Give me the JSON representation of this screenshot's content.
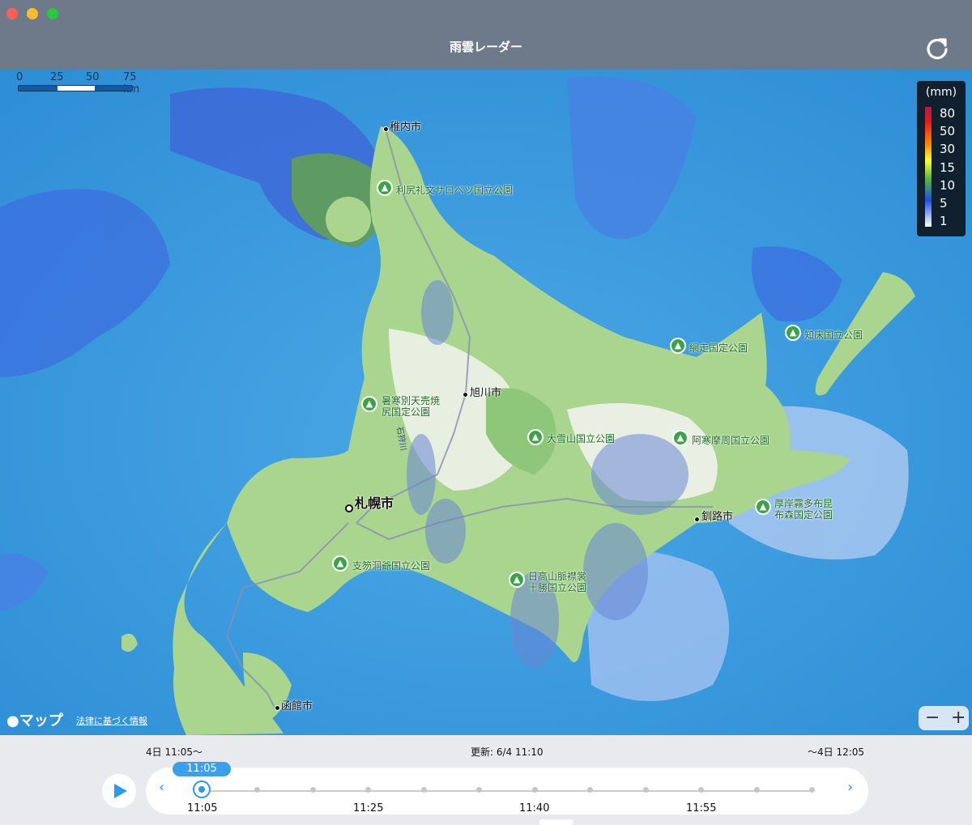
{
  "window": {
    "title": "雨雲レーダー"
  },
  "scale": {
    "labels": [
      "0",
      "25",
      "50",
      "75 km"
    ]
  },
  "legend": {
    "unit": "(mm)",
    "values": [
      "80",
      "50",
      "30",
      "15",
      "10",
      "5",
      "1"
    ]
  },
  "places": {
    "wakkanai": "稚内市",
    "rishiri": "利尻礼文サロベツ国立公園",
    "abashiri": "網走国定公園",
    "shiretoko": "知床国立公園",
    "shokanbetsu_1": "暑寒別天売焼",
    "shokanbetsu_2": "尻国定公園",
    "asahikawa": "旭川市",
    "daisetsuzan": "大雪山国立公園",
    "akan": "阿寒摩周国立公園",
    "sapporo": "札幌市",
    "akkeshi_1": "厚岸霧多布昆",
    "akkeshi_2": "布森国定公園",
    "kushiro": "釧路市",
    "shikotsu": "支笏洞爺国立公園",
    "hidaka_1": "日高山脈襟裳",
    "hidaka_2": "十勝国立公園",
    "hakodate": "函館市",
    "river": "石狩川"
  },
  "map_footer": {
    "brand": "マップ",
    "legal": "法律に基づく情報"
  },
  "zoom": {
    "minus": "−",
    "plus": "+"
  },
  "timeline": {
    "start": "4日 11:05〜",
    "updated": "更新: 6/4 11:10",
    "end": "〜4日 12:05",
    "current": "11:05",
    "labels": [
      "11:05",
      "11:25",
      "11:40",
      "11:55"
    ],
    "prev": "‹",
    "next": "›"
  }
}
